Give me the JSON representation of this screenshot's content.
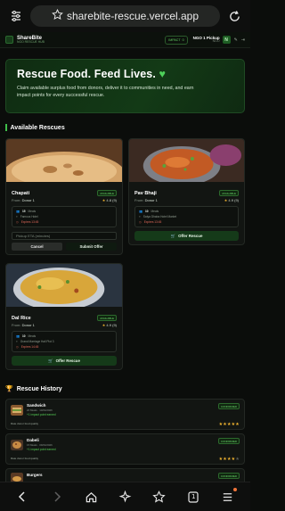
{
  "browser": {
    "url": "sharebite-rescue.vercel.app",
    "tab_count": "1"
  },
  "app": {
    "brand": "ShareBite",
    "tagline": "NGO RESCUE HUB",
    "impact_label": "IMPACT",
    "impact_value": "0",
    "ngo_name": "NGO 1 Pickup",
    "ngo_sub": "NGO",
    "avatar_initial": "N"
  },
  "hero": {
    "title": "Rescue Food. Feed Lives.",
    "subtitle": "Claim available surplus food from donors, deliver it to communities in need, and earn impact points for every successful rescue."
  },
  "available": {
    "section_title": "Available Rescues",
    "cards": [
      {
        "title": "Chapati",
        "status": "AVAILABLE",
        "from_label": "From:",
        "donor": "Donor 1",
        "rating": "4.8",
        "rating_count": "(9)",
        "quantity": "15",
        "quantity_unit": "Meals",
        "location": "Famous Hotel",
        "expires": "Expires 13:45",
        "pickup_placeholder": "Pickup ETA (minutes)",
        "cancel_label": "Cancel",
        "submit_label": "Submit Offer"
      },
      {
        "title": "Pav Bhaji",
        "status": "AVAILABLE",
        "from_label": "From:",
        "donor": "Donor 1",
        "rating": "4.9",
        "rating_count": "(9)",
        "quantity": "10",
        "quantity_unit": "Meals",
        "location": "Satya Dhaba Hotel Market",
        "expires": "Expires 13:45",
        "offer_label": "Offer Rescue"
      },
      {
        "title": "Dal Rice",
        "status": "AVAILABLE",
        "from_label": "From:",
        "donor": "Donor 1",
        "rating": "4.9",
        "rating_count": "(9)",
        "quantity": "10",
        "quantity_unit": "Meals",
        "location": "Grand Marriage Hall Plot 3",
        "expires": "Expires 14:45",
        "offer_label": "Offer Rescue"
      }
    ]
  },
  "history": {
    "section_title": "Rescue History",
    "items": [
      {
        "name": "Sandwich",
        "meta": "20 Meals · 10/04/2026",
        "points": "+1 impact point earned",
        "note": "Rate donor food quality",
        "status": "CONFIRMED",
        "stars": 5
      },
      {
        "name": "Dabeli",
        "meta": "15 Meals · 09/04/2026",
        "points": "+1 impact point earned",
        "note": "Rate donor food quality",
        "status": "CONFIRMED",
        "stars": 4
      },
      {
        "name": "Burgers",
        "meta": "",
        "points": "",
        "note": "",
        "status": "CONFIRMED",
        "stars": 0
      }
    ]
  },
  "colors": {
    "accent": "#3fbf4a",
    "background": "#0b0d0b",
    "expire": "#e46a5b",
    "star": "#f2b530"
  }
}
